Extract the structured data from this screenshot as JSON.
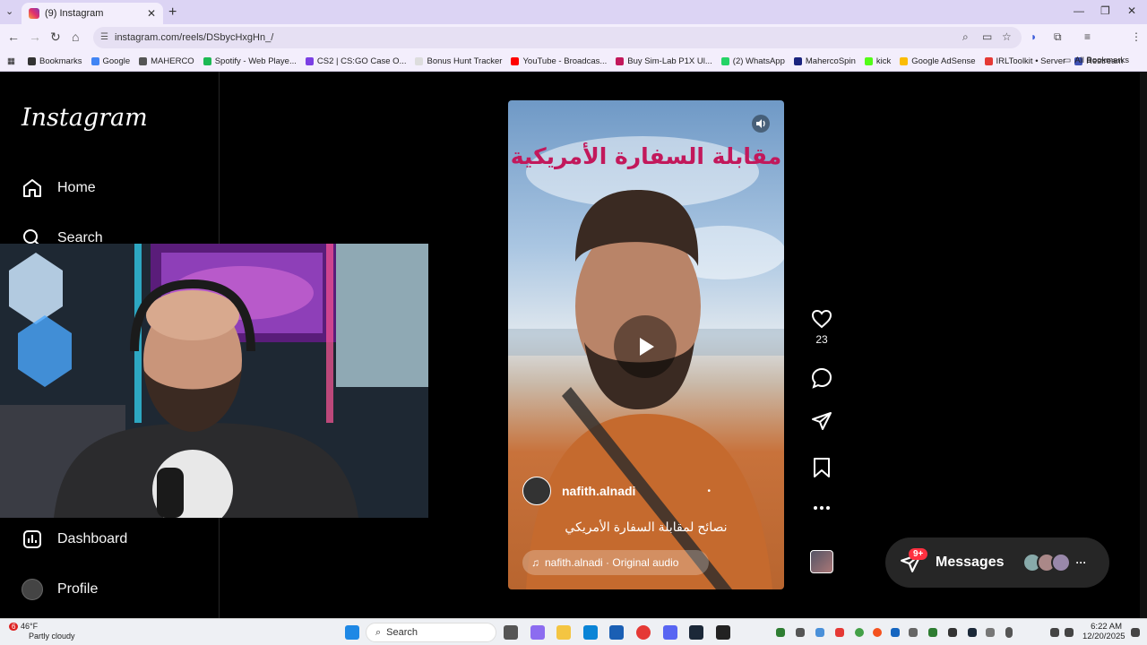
{
  "browser": {
    "tab_title": "(9) Instagram",
    "url": "instagram.com/reels/DSbycHxgHn_/",
    "new_tab": "+",
    "tab_close": "✕",
    "window_controls": [
      "—",
      "❐",
      "✕"
    ]
  },
  "bookmarks": [
    {
      "label": "Bookmarks",
      "color": "#333333"
    },
    {
      "label": "Google",
      "color": "#4285f4"
    },
    {
      "label": "MAHERCO",
      "color": "#555555"
    },
    {
      "label": "Spotify - Web Playe...",
      "color": "#1db954"
    },
    {
      "label": "CS2 | CS:GO Case O...",
      "color": "#7b3fe4"
    },
    {
      "label": "Bonus Hunt Tracker",
      "color": "#dddddd"
    },
    {
      "label": "YouTube - Broadcas...",
      "color": "#ff0000"
    },
    {
      "label": "Buy Sim-Lab P1X Ul...",
      "color": "#c2185b"
    },
    {
      "label": "(2) WhatsApp",
      "color": "#25d366"
    },
    {
      "label": "MahercoSpin",
      "color": "#1a237e"
    },
    {
      "label": "kick",
      "color": "#53fc18"
    },
    {
      "label": "Google AdSense",
      "color": "#fbbc04"
    },
    {
      "label": "IRLToolkit • Server",
      "color": "#e53935"
    },
    {
      "label": "Restream",
      "color": "#3f51b5"
    }
  ],
  "all_bookmarks": "All Bookmarks",
  "sidebar": {
    "logo": "Instagram",
    "items": [
      {
        "label": "Home",
        "icon": "home-icon"
      },
      {
        "label": "Search",
        "icon": "search-icon"
      },
      {
        "label": "Dashboard",
        "icon": "dashboard-icon"
      },
      {
        "label": "Profile",
        "icon": "profile-avatar"
      }
    ]
  },
  "reel": {
    "title_overlay": "مقابلة السفارة الأمريكية",
    "author": "nafith.alnadi",
    "caption": "نصائح لمقابلة السفارة الأمريكي",
    "audio": "nafith.alnadi · Original audio",
    "separator": "•"
  },
  "actions": {
    "likes": "23"
  },
  "messages": {
    "label": "Messages",
    "badge": "9+",
    "more": "···"
  },
  "taskbar": {
    "weather_badge": "6",
    "temperature": "46°F",
    "condition": "Partly cloudy",
    "search": "Search",
    "time": "6:22 AM",
    "date": "12/20/2025"
  }
}
